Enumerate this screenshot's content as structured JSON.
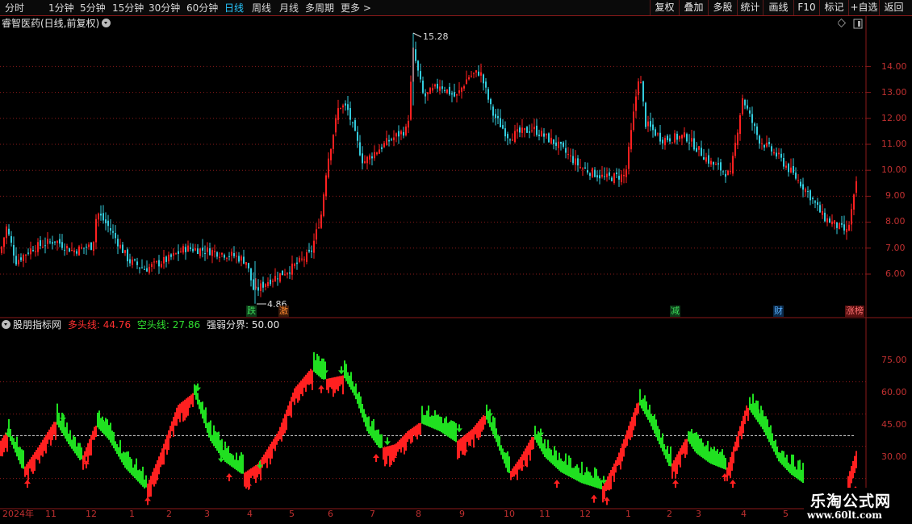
{
  "toolbar": {
    "periods": [
      "分时",
      "1分钟",
      "5分钟",
      "15分钟",
      "30分钟",
      "60分钟",
      "日线",
      "周线",
      "月线",
      "多周期",
      "更多 >"
    ],
    "active_period": "日线",
    "right_buttons": [
      "复权",
      "叠加",
      "多股",
      "统计",
      "画线",
      "F10",
      "标记",
      "+自选",
      "返回"
    ]
  },
  "price_panel": {
    "title": "睿智医药(日线,前复权)",
    "y_ticks": [
      "14.00",
      "13.00",
      "12.00",
      "11.00",
      "10.00",
      "9.00",
      "8.00",
      "7.00",
      "6.00"
    ],
    "high_marker": "15.28",
    "low_marker": "4.86",
    "events": [
      "跌",
      "激",
      "减",
      "财",
      "涨榜"
    ]
  },
  "indicator": {
    "name": "股朋指标网",
    "bull_label": "多头线:",
    "bull_value": "44.76",
    "bear_label": "空头线:",
    "bear_value": "27.86",
    "bound_label": "强弱分界:",
    "bound_value": "50.00",
    "y_ticks": [
      "75.00",
      "60.00",
      "45.00",
      "30.00"
    ]
  },
  "x_axis": [
    "2024年",
    "11",
    "12",
    "1",
    "2",
    "3",
    "4",
    "5",
    "6",
    "7",
    "8",
    "9",
    "10",
    "11",
    "12",
    "1",
    "2",
    "3",
    "4",
    "5"
  ],
  "watermark": {
    "title": "乐淘公式网",
    "url": "www.60lt.com"
  },
  "colors": {
    "up": "#ff2020",
    "down": "#20e020",
    "cyan": "#33ccdd",
    "grid": "#8b1a1a"
  }
}
